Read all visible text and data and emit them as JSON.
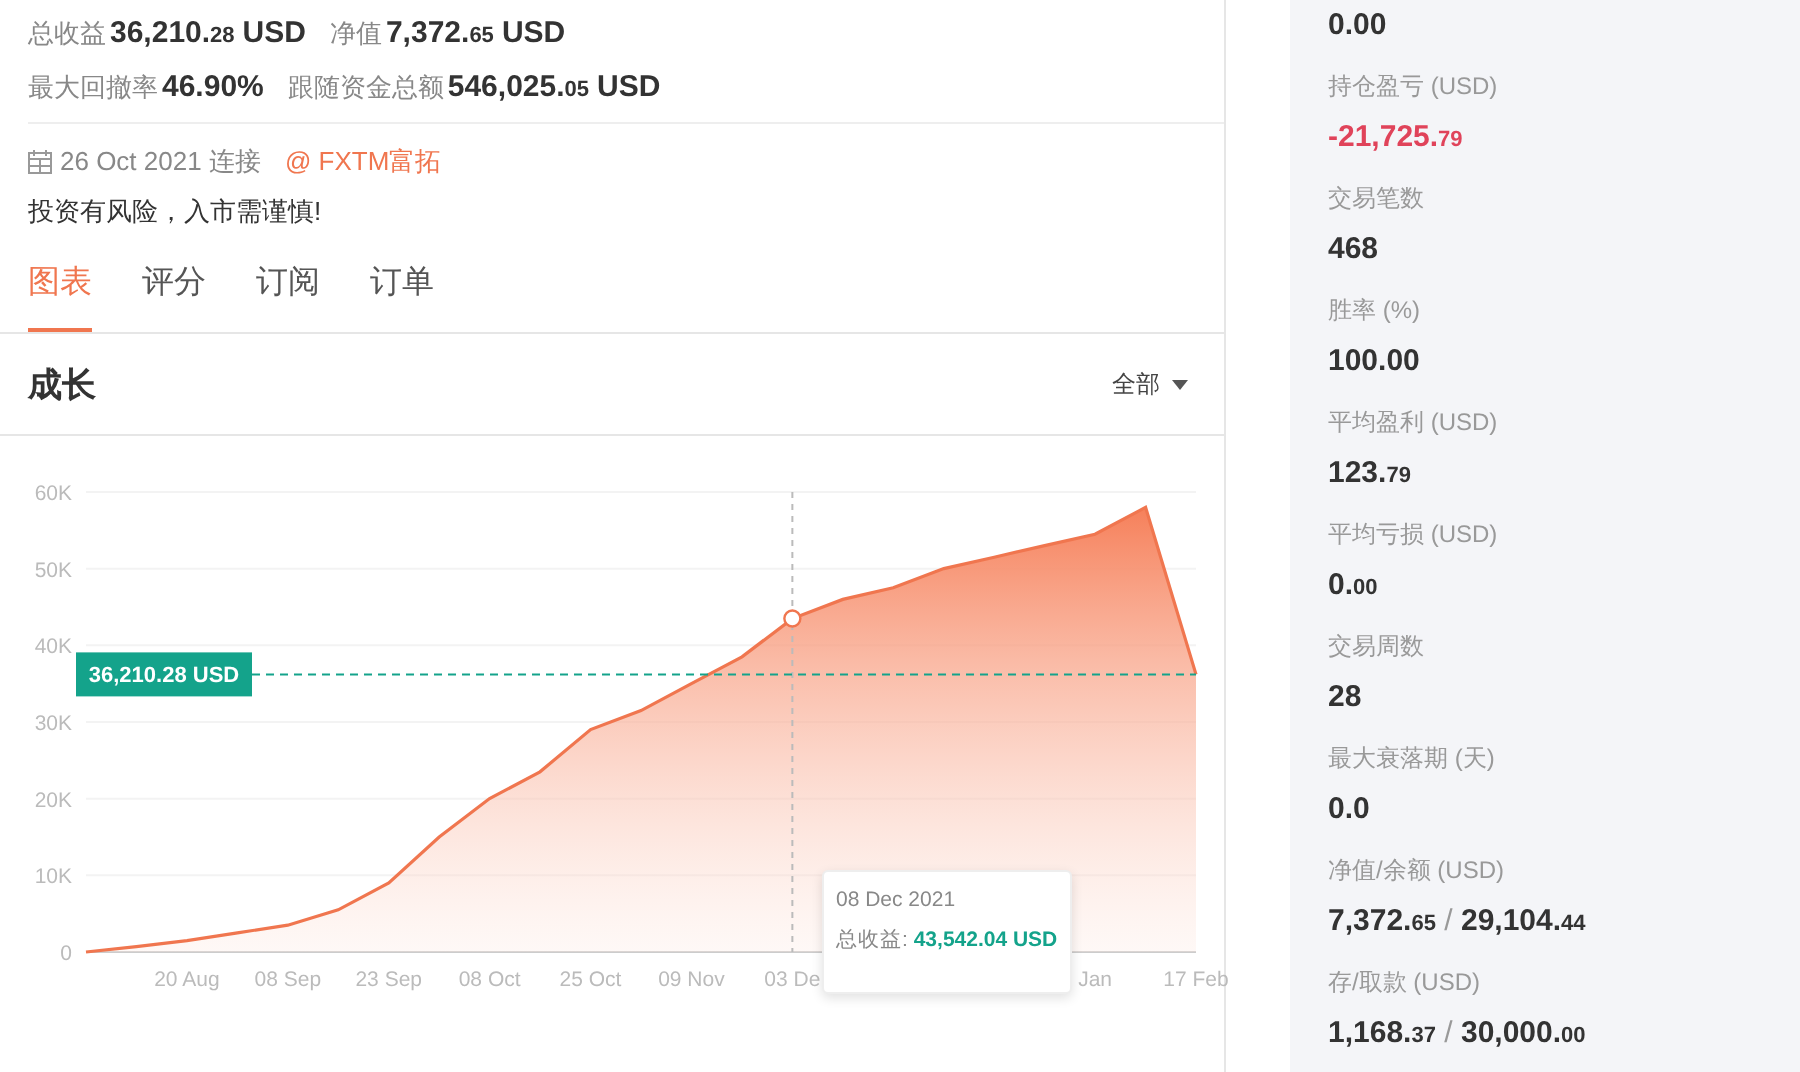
{
  "summary": [
    {
      "label": "总收益",
      "value": [
        {
          "kind": "big",
          "text": "36,210."
        },
        {
          "kind": "small",
          "text": "28"
        },
        {
          "kind": "unit",
          "text": "USD"
        }
      ]
    },
    {
      "label": "净值",
      "value": [
        {
          "kind": "big",
          "text": "7,372."
        },
        {
          "kind": "small",
          "text": "65"
        },
        {
          "kind": "unit",
          "text": "USD"
        }
      ]
    },
    {
      "label": "最大回撤率",
      "value": [
        {
          "kind": "big",
          "text": "46.90%"
        }
      ]
    },
    {
      "label": "跟随资金总额",
      "value": [
        {
          "kind": "big",
          "text": "546,025."
        },
        {
          "kind": "small",
          "text": "05"
        },
        {
          "kind": "unit",
          "text": "USD"
        }
      ]
    }
  ],
  "connection": {
    "date": "26 Oct 2021 连接",
    "broker": "@ FXTM富拓"
  },
  "risk_notice": "投资有风险，入市需谨慎!",
  "tabs": [
    {
      "label": "图表",
      "selected": true
    },
    {
      "label": "评分",
      "selected": false
    },
    {
      "label": "订阅",
      "selected": false
    },
    {
      "label": "订单",
      "selected": false
    }
  ],
  "chart_panel": {
    "title": "成长",
    "range_dropdown": "全部",
    "chart_data": {
      "type": "area",
      "ylim": [
        0,
        60000
      ],
      "categories": [
        null,
        null,
        "20 Aug",
        null,
        "08 Sep",
        null,
        "23 Sep",
        null,
        "08 Oct",
        null,
        "25 Oct",
        null,
        "09 Nov",
        null,
        "03 De",
        null,
        null,
        null,
        null,
        null,
        "Jan",
        null,
        "17 Feb"
      ],
      "series": [
        {
          "color": "#f0764f",
          "values": [
            0,
            700,
            1500,
            2500,
            3500,
            5500,
            9000,
            15000,
            20000,
            23500,
            29000,
            31500,
            35000,
            38500,
            43500,
            46000,
            47500,
            50000,
            51500,
            53000,
            54500,
            58000,
            36200
          ]
        }
      ],
      "yticks": [
        {
          "value": 0,
          "label": "0"
        },
        {
          "value": 10000,
          "label": "10K"
        },
        {
          "value": 20000,
          "label": "20K"
        },
        {
          "value": 30000,
          "label": "30K"
        },
        {
          "value": 40000,
          "label": "40K"
        },
        {
          "value": 50000,
          "label": "50K"
        },
        {
          "value": 60000,
          "label": "60K"
        }
      ],
      "grid": true,
      "ref_lines": [
        {
          "axis": "y",
          "value": 36210.28,
          "label": "36,210.28 USD"
        }
      ]
    },
    "tooltip": {
      "date": "08 Dec 2021",
      "label": "总收益:",
      "value": "43,542.04 USD"
    }
  },
  "stats": [
    {
      "value": [
        {
          "kind": "big",
          "text": "0.00"
        }
      ]
    },
    {
      "label": "持仓盈亏 (USD)",
      "color": "#e0435a",
      "value": [
        {
          "kind": "big",
          "text": "-21,725."
        },
        {
          "kind": "small",
          "text": "79"
        }
      ]
    },
    {
      "label": "交易笔数",
      "value": [
        {
          "kind": "big",
          "text": "468"
        }
      ]
    },
    {
      "label": "胜率 (%)",
      "value": [
        {
          "kind": "big",
          "text": "100.00"
        }
      ]
    },
    {
      "label": "平均盈利 (USD)",
      "value": [
        {
          "kind": "big",
          "text": "123."
        },
        {
          "kind": "small",
          "text": "79"
        }
      ]
    },
    {
      "label": "平均亏损 (USD)",
      "value": [
        {
          "kind": "big",
          "text": "0."
        },
        {
          "kind": "small",
          "text": "00"
        }
      ]
    },
    {
      "label": "交易周数",
      "value": [
        {
          "kind": "big",
          "text": "28"
        }
      ]
    },
    {
      "label": "最大衰落期 (天)",
      "value": [
        {
          "kind": "big",
          "text": "0.0"
        }
      ]
    },
    {
      "label": "净值/余额 (USD)",
      "value": [
        {
          "kind": "big",
          "text": "7,372."
        },
        {
          "kind": "small",
          "text": "65"
        },
        {
          "kind": "sep",
          "text": " / "
        },
        {
          "kind": "big",
          "text": "29,104."
        },
        {
          "kind": "small",
          "text": "44"
        }
      ]
    },
    {
      "label": "存/取款 (USD)",
      "value": [
        {
          "kind": "big",
          "text": "1,168."
        },
        {
          "kind": "small",
          "text": "37"
        },
        {
          "kind": "sep",
          "text": " / "
        },
        {
          "kind": "big",
          "text": "30,000."
        },
        {
          "kind": "small",
          "text": "00"
        }
      ]
    }
  ]
}
